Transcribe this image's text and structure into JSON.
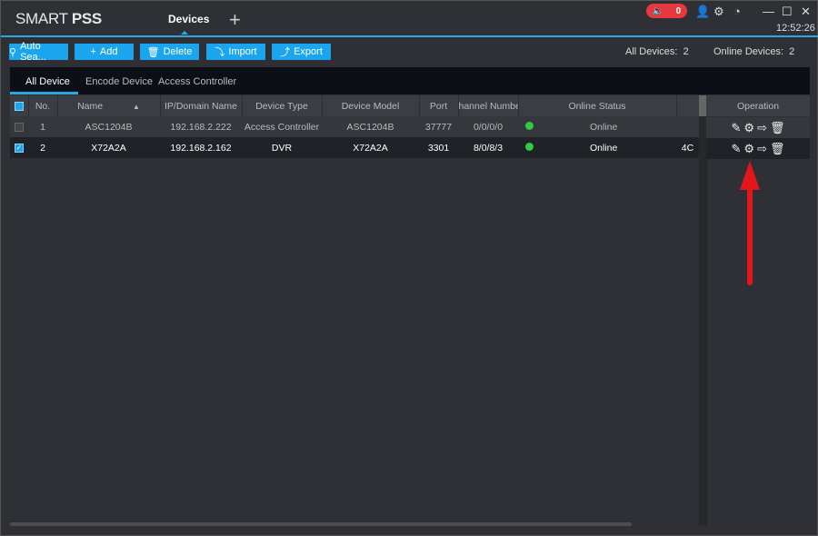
{
  "app": {
    "logo_light": "SMART ",
    "logo_bold": "PSS",
    "tab": "Devices",
    "clock": "12:52:26",
    "alarm_count": "0"
  },
  "toolbar": {
    "auto_search": "Auto Sea...",
    "add": "Add",
    "delete": "Delete",
    "import": "Import",
    "export": "Export",
    "all_devices_label": "All Devices:",
    "all_devices": "2",
    "online_devices_label": "Online Devices:",
    "online_devices": "2"
  },
  "subtabs": [
    "All Device",
    "Encode Device",
    "Access Controller"
  ],
  "table": {
    "headers": [
      "No.",
      "Name",
      "IP/Domain Name",
      "Device Type",
      "Device Model",
      "Port",
      "hannel Numbe",
      "Online Status",
      ""
    ],
    "operation_header": "Operation",
    "rows": [
      {
        "checked": false,
        "no": "1",
        "name": "ASC1204B",
        "ip": "192.168.2.222",
        "type": "Access Controller",
        "model": "ASC1204B",
        "port": "37777",
        "channels": "0/0/0/0",
        "status": "Online",
        "extra": ""
      },
      {
        "checked": true,
        "no": "2",
        "name": "X72A2A",
        "ip": "192.168.2.162",
        "type": "DVR",
        "model": "X72A2A",
        "port": "3301",
        "channels": "8/0/8/3",
        "status": "Online",
        "extra": "4C"
      }
    ]
  },
  "colors": {
    "accent": "#1aa5ee",
    "alarm": "#e5393f",
    "online": "#2ecc40",
    "arrow": "#e3161b"
  }
}
